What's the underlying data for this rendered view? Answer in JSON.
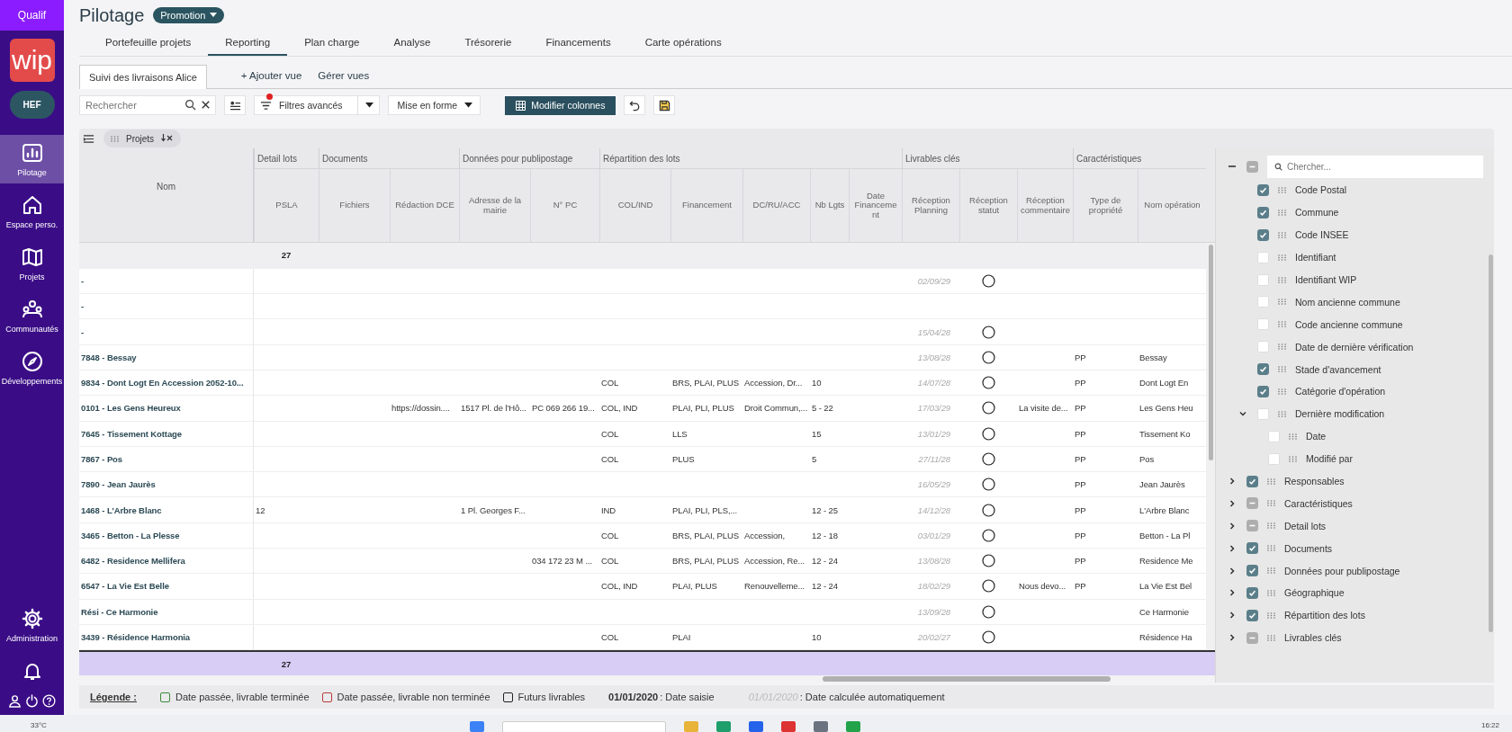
{
  "sidebar": {
    "env_label": "Qualif",
    "logo": "wip",
    "org_badge": "HEF",
    "items": [
      {
        "label": "Pilotage",
        "kind": "chart",
        "selected": true
      },
      {
        "label": "Espace perso.",
        "kind": "home",
        "selected": false
      },
      {
        "label": "Projets",
        "kind": "map",
        "selected": false
      },
      {
        "label": "Communautés",
        "kind": "people",
        "selected": false
      },
      {
        "label": "Développements",
        "kind": "compass",
        "selected": false
      }
    ],
    "admin": {
      "label": "Administration"
    }
  },
  "header": {
    "title": "Pilotage",
    "scope": "Promotion"
  },
  "tabs": [
    {
      "label": "Portefeuille projets",
      "selected": false
    },
    {
      "label": "Reporting",
      "selected": true
    },
    {
      "label": "Plan charge",
      "selected": false
    },
    {
      "label": "Analyse",
      "selected": false
    },
    {
      "label": "Trésorerie",
      "selected": false
    },
    {
      "label": "Financements",
      "selected": false
    },
    {
      "label": "Carte opérations",
      "selected": false
    }
  ],
  "views": {
    "tabs": [
      {
        "label": "Suivi des livraisons Alice",
        "selected": true
      }
    ],
    "add": "+ Ajouter vue",
    "manage": "Gérer vues"
  },
  "toolbar": {
    "search_placeholder": "Rechercher",
    "advanced_filters": "Filtres avancés",
    "filters_active": true,
    "format": "Mise en forme",
    "edit_columns": "Modifier colonnes"
  },
  "grid": {
    "group_by": "Projets",
    "name_column": "Nom",
    "groups": [
      {
        "label": "Detail lots",
        "columns": [
          "PSLA"
        ]
      },
      {
        "label": "Documents",
        "columns": [
          "Fichiers",
          "Rédaction DCE"
        ]
      },
      {
        "label": "Données pour publipostage",
        "columns": [
          "Adresse de la mairie",
          "N° PC"
        ]
      },
      {
        "label": "Répartition des lots",
        "columns": [
          "COL/IND",
          "Financement",
          "DC/RU/ACC",
          "Nb Lgts",
          "Date Financement"
        ]
      },
      {
        "label": "Livrables clés",
        "columns": [
          "Réception Planning",
          "Réception statut",
          "Réception commentaire"
        ]
      },
      {
        "label": "Caractéristiques",
        "columns": [
          "Type de propriété",
          "Nom opération"
        ]
      }
    ],
    "total": "27",
    "rows": [
      {
        "name": "-",
        "reception_planning": "02/09/29",
        "reception_done": false
      },
      {
        "name": "-"
      },
      {
        "name": "-",
        "reception_planning": "15/04/28",
        "reception_done": false
      },
      {
        "name": "7848 - Bessay",
        "reception_planning": "13/08/28",
        "reception_done": false,
        "type_propriete": "PP",
        "nom_operation": "Bessay"
      },
      {
        "name": "9834 - Dont Logt En Accession 2052-10...",
        "col_ind": "COL",
        "financement": "BRS, PLAI, PLUS",
        "dc_ru_acc": "Accession, Dr...",
        "nb_lgts": "10",
        "reception_planning": "14/07/28",
        "reception_done": false,
        "type_propriete": "PP",
        "nom_operation": "Dont Logt En"
      },
      {
        "name": "0101 - Les Gens Heureux",
        "redaction_dce": "https://dossin....",
        "adresse_mairie": "1517 Pl. de l'Hô...",
        "n_pc": "PC 069 266 19...",
        "col_ind": "COL, IND",
        "financement": "PLAI, PLI, PLUS",
        "dc_ru_acc": "Droit Commun,...",
        "nb_lgts": "5 - 22",
        "reception_planning": "17/03/29",
        "reception_done": false,
        "reception_commentaire": "La visite de...",
        "type_propriete": "PP",
        "nom_operation": "Les Gens Heu"
      },
      {
        "name": "7645 - Tissement Kottage",
        "col_ind": "COL",
        "financement": "LLS",
        "nb_lgts": "15",
        "reception_planning": "13/01/29",
        "reception_done": false,
        "type_propriete": "PP",
        "nom_operation": "Tissement Ko"
      },
      {
        "name": "7867 - Pos",
        "col_ind": "COL",
        "financement": "PLUS",
        "nb_lgts": "5",
        "reception_planning": "27/11/28",
        "reception_done": false,
        "type_propriete": "PP",
        "nom_operation": "Pos"
      },
      {
        "name": "7890 - Jean Jaurès",
        "reception_planning": "16/05/29",
        "reception_done": false,
        "type_propriete": "PP",
        "nom_operation": "Jean Jaurès"
      },
      {
        "name": "1468 - L'Arbre Blanc",
        "psla": "12",
        "adresse_mairie": "1 Pl. Georges F...",
        "col_ind": "IND",
        "financement": "PLAI, PLI, PLS,...",
        "nb_lgts": "12 - 25",
        "reception_planning": "14/12/28",
        "reception_done": false,
        "type_propriete": "PP",
        "nom_operation": "L'Arbre Blanc"
      },
      {
        "name": "3465 - Betton - La Plesse",
        "col_ind": "COL",
        "financement": "BRS, PLAI, PLUS",
        "dc_ru_acc": "Accession,",
        "nb_lgts": "12 - 18",
        "reception_planning": "03/01/29",
        "reception_done": false,
        "type_propriete": "PP",
        "nom_operation": "Betton - La Pl"
      },
      {
        "name": "6482 - Residence Mellifera",
        "n_pc": "034 172 23 M ...",
        "col_ind": "COL",
        "financement": "BRS, PLAI, PLUS",
        "dc_ru_acc": "Accession, Re...",
        "nb_lgts": "12 - 24",
        "reception_planning": "13/08/28",
        "reception_done": false,
        "type_propriete": "PP",
        "nom_operation": "Residence Me"
      },
      {
        "name": "6547 - La Vie Est Belle",
        "col_ind": "COL, IND",
        "financement": "PLAI, PLUS",
        "dc_ru_acc": "Renouvelleme...",
        "nb_lgts": "12 - 24",
        "reception_planning": "18/02/29",
        "reception_done": false,
        "reception_commentaire": "Nous devo...",
        "type_propriete": "PP",
        "nom_operation": "La Vie Est Bel"
      },
      {
        "name": "Rési - Ce Harmonie",
        "reception_planning": "13/09/28",
        "reception_done": false,
        "nom_operation": "Ce Harmonie"
      },
      {
        "name": "3439 - Résidence Harmonia",
        "col_ind": "COL",
        "financement": "PLAI",
        "nb_lgts": "10",
        "reception_planning": "20/02/27",
        "reception_done": false,
        "nom_operation": "Résidence Ha"
      }
    ],
    "footer_total": "27"
  },
  "column_panel": {
    "search_placeholder": "Chercher...",
    "all_partial": true,
    "subitems": [
      {
        "label": "Code Postal",
        "checked": true
      },
      {
        "label": "Commune",
        "checked": true
      },
      {
        "label": "Code INSEE",
        "checked": true
      },
      {
        "label": "Identifiant",
        "checked": false
      },
      {
        "label": "Identifiant WIP",
        "checked": false
      },
      {
        "label": "Nom ancienne commune",
        "checked": false
      },
      {
        "label": "Code ancienne commune",
        "checked": false
      },
      {
        "label": "Date de dernière vérification",
        "checked": false
      },
      {
        "label": "Stade d'avancement",
        "checked": true
      },
      {
        "label": "Catégorie d'opération",
        "checked": true
      },
      {
        "label": "Dernière modification",
        "checked": false,
        "expanded": true,
        "children": [
          {
            "label": "Date",
            "checked": false
          },
          {
            "label": "Modifié par",
            "checked": false
          }
        ]
      }
    ],
    "groups": [
      {
        "label": "Responsables",
        "checked": true,
        "partial": false,
        "expanded": false
      },
      {
        "label": "Caractéristiques",
        "checked": false,
        "partial": true,
        "expanded": false
      },
      {
        "label": "Detail lots",
        "checked": false,
        "partial": true,
        "expanded": false
      },
      {
        "label": "Documents",
        "checked": true,
        "partial": false,
        "expanded": false
      },
      {
        "label": "Données pour publipostage",
        "checked": true,
        "partial": false,
        "expanded": false
      },
      {
        "label": "Géographique",
        "checked": true,
        "partial": false,
        "expanded": false
      },
      {
        "label": "Répartition des lots",
        "checked": true,
        "partial": false,
        "expanded": false
      },
      {
        "label": "Livrables clés",
        "checked": false,
        "partial": true,
        "expanded": false
      }
    ]
  },
  "legend": {
    "title": "Légende :",
    "items": [
      {
        "label": "Date passée, livrable terminée",
        "color": "#3a8a3a"
      },
      {
        "label": "Date passée, livrable non terminée",
        "color": "#b83a3a"
      },
      {
        "label": "Futurs livrables",
        "color": "#222222"
      }
    ],
    "entered": {
      "sample": "01/01/2020",
      "label": ": Date saisie"
    },
    "computed": {
      "sample": "01/01/2020",
      "label": ": Date calculée automatiquement"
    }
  },
  "taskbar": {
    "weather": "33°C",
    "time": "16:22"
  }
}
